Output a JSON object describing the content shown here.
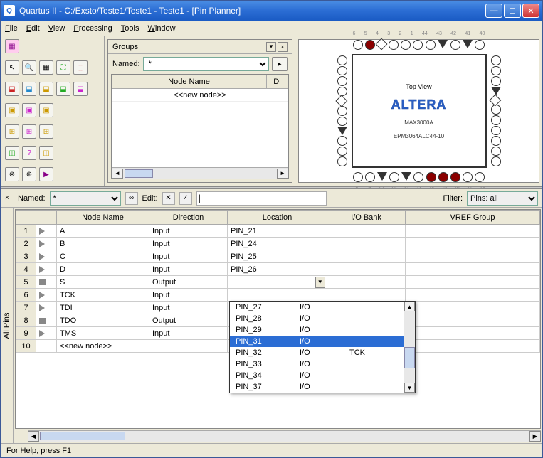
{
  "title": "Quartus II - C:/Exsto/Teste1/Teste1 - Teste1 - [Pin Planner]",
  "menus": {
    "file": "File",
    "edit": "Edit",
    "view": "View",
    "processing": "Processing",
    "tools": "Tools",
    "window": "Window"
  },
  "groups": {
    "panel_title": "Groups",
    "named_label": "Named:",
    "named_value": "*",
    "col_node": "Node Name",
    "col_di": "Di",
    "new_node": "<<new node>>"
  },
  "chip": {
    "top_label": "Top View",
    "logo": "ALTERA",
    "family": "MAX3000A",
    "part": "EPM3064ALC44-10",
    "top_nums": [
      "6",
      "5",
      "4",
      "3",
      "2",
      "1",
      "44",
      "43",
      "42",
      "41",
      "40"
    ],
    "bottom_nums": [
      "18",
      "19",
      "20",
      "21",
      "22",
      "23",
      "24",
      "25",
      "26",
      "27",
      "28"
    ]
  },
  "lower": {
    "named_label": "Named:",
    "named_value": "*",
    "edit_label": "Edit:",
    "filter_label": "Filter:",
    "filter_value": "Pins: all"
  },
  "table": {
    "cols": {
      "num": "",
      "node": "Node Name",
      "dir": "Direction",
      "loc": "Location",
      "bank": "I/O Bank",
      "vref": "VREF Group"
    },
    "rows": [
      {
        "n": "1",
        "node": "A",
        "dir": "Input",
        "loc": "PIN_21",
        "kind": "in"
      },
      {
        "n": "2",
        "node": "B",
        "dir": "Input",
        "loc": "PIN_24",
        "kind": "in"
      },
      {
        "n": "3",
        "node": "C",
        "dir": "Input",
        "loc": "PIN_25",
        "kind": "in"
      },
      {
        "n": "4",
        "node": "D",
        "dir": "Input",
        "loc": "PIN_26",
        "kind": "in"
      },
      {
        "n": "5",
        "node": "S",
        "dir": "Output",
        "loc": "",
        "kind": "io",
        "editing": true
      },
      {
        "n": "6",
        "node": "TCK",
        "dir": "Input",
        "loc": "",
        "kind": "in"
      },
      {
        "n": "7",
        "node": "TDI",
        "dir": "Input",
        "loc": "",
        "kind": "in"
      },
      {
        "n": "8",
        "node": "TDO",
        "dir": "Output",
        "loc": "",
        "kind": "io"
      },
      {
        "n": "9",
        "node": "TMS",
        "dir": "Input",
        "loc": "",
        "kind": "in"
      },
      {
        "n": "10",
        "node": "<<new node>>",
        "dir": "",
        "loc": "",
        "kind": ""
      }
    ],
    "dropdown": [
      {
        "pin": "PIN_27",
        "type": "I/O",
        "extra": ""
      },
      {
        "pin": "PIN_28",
        "type": "I/O",
        "extra": ""
      },
      {
        "pin": "PIN_29",
        "type": "I/O",
        "extra": ""
      },
      {
        "pin": "PIN_31",
        "type": "I/O",
        "extra": "",
        "selected": true
      },
      {
        "pin": "PIN_32",
        "type": "I/O",
        "extra": "TCK"
      },
      {
        "pin": "PIN_33",
        "type": "I/O",
        "extra": ""
      },
      {
        "pin": "PIN_34",
        "type": "I/O",
        "extra": ""
      },
      {
        "pin": "PIN_37",
        "type": "I/O",
        "extra": ""
      }
    ]
  },
  "vert_tab": "All Pins",
  "status": "For Help, press F1"
}
